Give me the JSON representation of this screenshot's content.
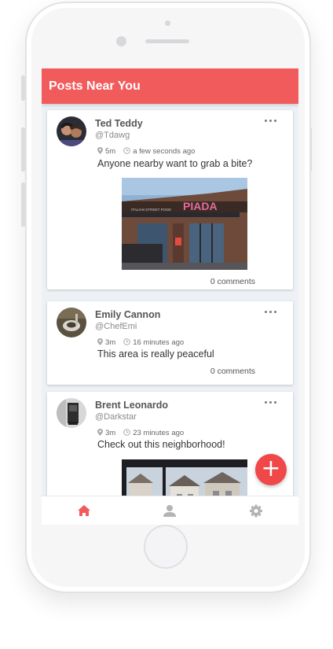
{
  "app": {
    "title": "Posts Near You",
    "accent_color": "#f25b5b"
  },
  "posts": [
    {
      "name": "Ted Teddy",
      "handle": "@Tdawg",
      "distance": "5m",
      "time": "a few seconds ago",
      "text": "Anyone nearby want to grab a bite?",
      "photo_sign": "PIADA",
      "photo_sign_small": "ITALIAN STREET FOOD",
      "comments": "0 comments"
    },
    {
      "name": "Emily Cannon",
      "handle": "@ChefEmi",
      "distance": "3m",
      "time": "16 minutes ago",
      "text": "This area is really peaceful",
      "comments": "0 comments"
    },
    {
      "name": "Brent Leonardo",
      "handle": "@Darkstar",
      "distance": "3m",
      "time": "23 minutes ago",
      "text": "Check out this neighborhood!"
    }
  ],
  "icons": {
    "location": "location-pin-icon",
    "clock": "clock-icon",
    "more": "more-horizontal-icon",
    "fab": "plus-icon",
    "nav": [
      "home-icon",
      "person-icon",
      "gear-icon"
    ]
  },
  "fab_label": "+",
  "nav": {
    "active": "home"
  }
}
